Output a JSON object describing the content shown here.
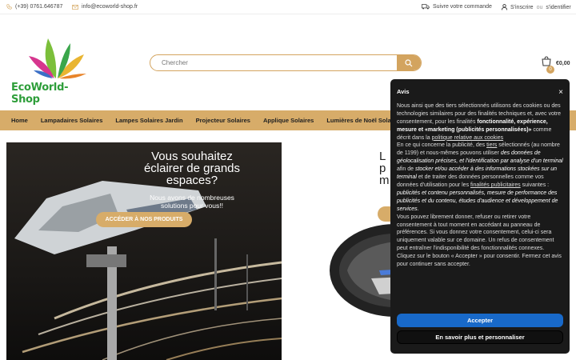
{
  "topbar": {
    "phone": "(+39) 0761.646787",
    "email": "info@ecoworld-shop.fr",
    "track_order": "Suivre votre commande",
    "register": "S'inscrire",
    "or": "ou",
    "login": "s'identifier"
  },
  "header": {
    "logo_text": "EcoWorld-Shop",
    "search_placeholder": "Chercher",
    "cart_count": "0",
    "cart_amount": "€0,00"
  },
  "nav": {
    "items": [
      "Home",
      "Lampadaires Solaires",
      "Lampes Solaires Jardin",
      "Projecteur Solaires",
      "Applique Solaires",
      "Lumières de Noël Solaires"
    ]
  },
  "hero": {
    "title_line1": "Vous souhaitez",
    "title_line2": "éclairer de grands",
    "title_line3": "espaces?",
    "subtitle_line1": "Nous avons de nombreuses",
    "subtitle_line2": "solutions pour vous!!",
    "button": "ACCÉDER À NOS PRODUITS"
  },
  "hero2": {
    "title_line1": "L",
    "title_line2": "p",
    "title_line3": "m"
  },
  "cookie": {
    "title": "Avis",
    "p1_a": "Nous ainsi que des tiers sélectionnés utilisons des cookies ou des technologies similaires pour des finalités techniques et, avec votre consentement, pour les finalités ",
    "p1_b": "fonctionnalité, expérience, mesure et «marketing (publicités personnalisées)»",
    "p1_c": " comme décrit dans la ",
    "p1_link": "politique relative aux cookies",
    "p2_a": "En ce qui concerne la publicité, des ",
    "p2_link1": "tiers",
    "p2_b": " sélectionnés (au nombre de 1199) et nous-mêmes pouvons utiliser ",
    "p2_c": "des données de géolocalisation précises, et l'identification par analyse d'un terminal",
    "p2_d": " afin de ",
    "p2_e": "stocker et/ou accéder à des informations stockées sur un terminal",
    "p2_f": " et de traiter des données personnelles comme vos données d'utilisation pour les ",
    "p2_link2": "finalités publicitaires",
    "p2_g": " suivantes : ",
    "p2_h": "publicités et contenu personnalisés, mesure de performance des publicités et du contenu, études d'audience et développement de services.",
    "p3": "Vous pouvez librement donner, refuser ou retirer votre consentement à tout moment en accédant au panneau de préférences. Si vous donnez votre consentement, celui-ci sera uniquement valable sur ce domaine. Un refus de consentement peut entraîner l'indisponibilité des fonctionnalités connexes.",
    "p4": "Cliquez sur le bouton « Accepter » pour consentir. Fermez cet avis pour continuer sans accepter.",
    "accept": "Accepter",
    "more": "En savoir plus et personnaliser"
  },
  "colors": {
    "accent": "#d7ac69",
    "cookie_bg": "#1a1a1a",
    "accept_btn": "#1869c9"
  }
}
